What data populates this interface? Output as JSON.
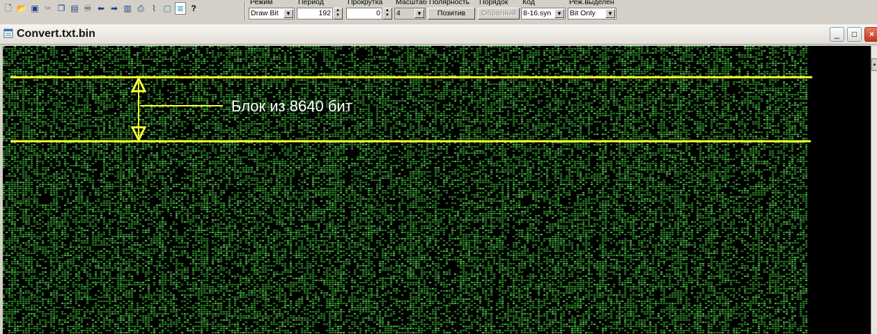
{
  "toolbar": {
    "icons": [
      "new-file-icon",
      "open-file-icon",
      "save-icon",
      "cut-icon",
      "copy-icon",
      "paste-icon",
      "find-icon",
      "back-arrow-icon",
      "forward-arrow-icon",
      "page-icon",
      "print-icon",
      "brush-icon",
      "frame-icon",
      "list-icon",
      "help-icon"
    ],
    "mode": {
      "label": "Режим",
      "value": "Draw Bit"
    },
    "period": {
      "label": "Период",
      "value": "192"
    },
    "scroll": {
      "label": "Прокрутка",
      "value": "0"
    },
    "scale": {
      "label": "Масштаб",
      "value": "4"
    },
    "polarity": {
      "label": "Полярность",
      "value": "Позитив"
    },
    "order": {
      "label": "Порядок",
      "value": "Обратный"
    },
    "code": {
      "label": "Код",
      "value": "8-16.syn"
    },
    "select_mode": {
      "label": "Реж.выделен",
      "value": "Bit Only"
    }
  },
  "window": {
    "title": "Convert.txt.bin",
    "minimize": "_",
    "maximize": "□",
    "close": "×"
  },
  "annotation": {
    "text": "Блок из 8640 бит",
    "color": "#ffff33"
  },
  "colors": {
    "bit_on": "#2f8a2a",
    "bit_bright": "#58c850",
    "background": "#000000"
  }
}
